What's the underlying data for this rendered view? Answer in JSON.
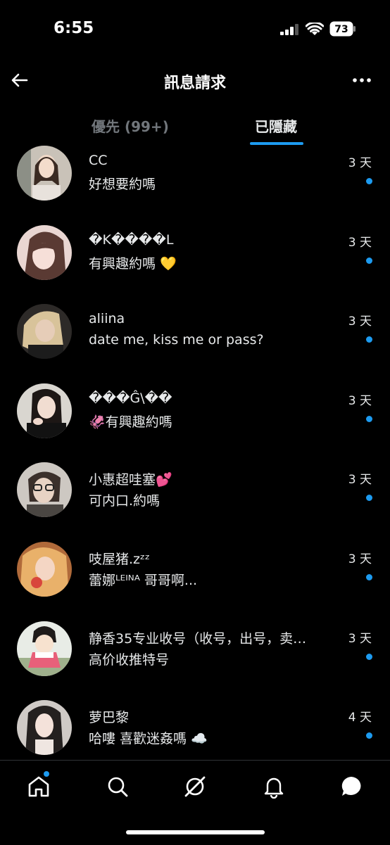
{
  "status_bar": {
    "time": "6:55",
    "battery": "73"
  },
  "header": {
    "title": "訊息請求",
    "back_icon": "arrow-left-icon",
    "more_icon": "more-horizontal-icon"
  },
  "tabs": [
    {
      "label": "優先 (99+)",
      "active": false
    },
    {
      "label": "已隱藏",
      "active": true
    }
  ],
  "colors": {
    "accent": "#1d9bf0",
    "background": "#000000",
    "text": "#e7e9ea",
    "muted": "#71767b"
  },
  "conversations": [
    {
      "name": "CC",
      "message": "好想要約嗎",
      "time": "3 天",
      "unread": true
    },
    {
      "name": "�K����L",
      "message": "有興趣約嗎 💛",
      "time": "3 天",
      "unread": true
    },
    {
      "name": "aliina",
      "message": "date me, kiss me or pass?",
      "time": "3 天",
      "unread": true
    },
    {
      "name": "���Ĝ\\��",
      "message": "🦑有興趣約嗎",
      "time": "3 天",
      "unread": true
    },
    {
      "name": "小惠超哇塞💕",
      "message": "可内口.約嗎",
      "time": "3 天",
      "unread": true
    },
    {
      "name": "吱屋猪.zᶻᶻ",
      "message": "蕾娜ᴸᴱᴵᴺᴬ 哥哥啊...",
      "time": "3 天",
      "unread": true
    },
    {
      "name": "静香35专业收号（收号，出号，卖…",
      "message": "高价收推特号",
      "time": "3 天",
      "unread": true
    },
    {
      "name": "萝巴黎",
      "message": "哈嘍 喜歡迷姦嗎 ☁️",
      "time": "4 天",
      "unread": true
    }
  ],
  "bottom_nav": [
    {
      "icon": "home-icon",
      "badge": true
    },
    {
      "icon": "search-icon",
      "badge": false
    },
    {
      "icon": "grok-icon",
      "badge": false
    },
    {
      "icon": "bell-icon",
      "badge": false
    },
    {
      "icon": "messages-icon",
      "badge": false
    }
  ]
}
